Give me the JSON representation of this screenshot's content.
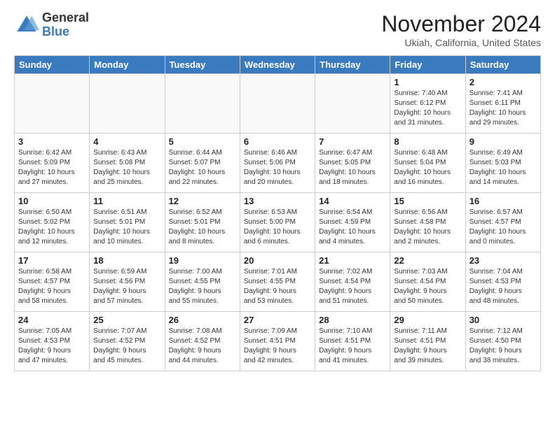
{
  "header": {
    "logo_general": "General",
    "logo_blue": "Blue",
    "month_title": "November 2024",
    "location": "Ukiah, California, United States"
  },
  "weekdays": [
    "Sunday",
    "Monday",
    "Tuesday",
    "Wednesday",
    "Thursday",
    "Friday",
    "Saturday"
  ],
  "weeks": [
    [
      {
        "day": "",
        "info": ""
      },
      {
        "day": "",
        "info": ""
      },
      {
        "day": "",
        "info": ""
      },
      {
        "day": "",
        "info": ""
      },
      {
        "day": "",
        "info": ""
      },
      {
        "day": "1",
        "info": "Sunrise: 7:40 AM\nSunset: 6:12 PM\nDaylight: 10 hours\nand 31 minutes."
      },
      {
        "day": "2",
        "info": "Sunrise: 7:41 AM\nSunset: 6:11 PM\nDaylight: 10 hours\nand 29 minutes."
      }
    ],
    [
      {
        "day": "3",
        "info": "Sunrise: 6:42 AM\nSunset: 5:09 PM\nDaylight: 10 hours\nand 27 minutes."
      },
      {
        "day": "4",
        "info": "Sunrise: 6:43 AM\nSunset: 5:08 PM\nDaylight: 10 hours\nand 25 minutes."
      },
      {
        "day": "5",
        "info": "Sunrise: 6:44 AM\nSunset: 5:07 PM\nDaylight: 10 hours\nand 22 minutes."
      },
      {
        "day": "6",
        "info": "Sunrise: 6:46 AM\nSunset: 5:06 PM\nDaylight: 10 hours\nand 20 minutes."
      },
      {
        "day": "7",
        "info": "Sunrise: 6:47 AM\nSunset: 5:05 PM\nDaylight: 10 hours\nand 18 minutes."
      },
      {
        "day": "8",
        "info": "Sunrise: 6:48 AM\nSunset: 5:04 PM\nDaylight: 10 hours\nand 16 minutes."
      },
      {
        "day": "9",
        "info": "Sunrise: 6:49 AM\nSunset: 5:03 PM\nDaylight: 10 hours\nand 14 minutes."
      }
    ],
    [
      {
        "day": "10",
        "info": "Sunrise: 6:50 AM\nSunset: 5:02 PM\nDaylight: 10 hours\nand 12 minutes."
      },
      {
        "day": "11",
        "info": "Sunrise: 6:51 AM\nSunset: 5:01 PM\nDaylight: 10 hours\nand 10 minutes."
      },
      {
        "day": "12",
        "info": "Sunrise: 6:52 AM\nSunset: 5:01 PM\nDaylight: 10 hours\nand 8 minutes."
      },
      {
        "day": "13",
        "info": "Sunrise: 6:53 AM\nSunset: 5:00 PM\nDaylight: 10 hours\nand 6 minutes."
      },
      {
        "day": "14",
        "info": "Sunrise: 6:54 AM\nSunset: 4:59 PM\nDaylight: 10 hours\nand 4 minutes."
      },
      {
        "day": "15",
        "info": "Sunrise: 6:56 AM\nSunset: 4:58 PM\nDaylight: 10 hours\nand 2 minutes."
      },
      {
        "day": "16",
        "info": "Sunrise: 6:57 AM\nSunset: 4:57 PM\nDaylight: 10 hours\nand 0 minutes."
      }
    ],
    [
      {
        "day": "17",
        "info": "Sunrise: 6:58 AM\nSunset: 4:57 PM\nDaylight: 9 hours\nand 58 minutes."
      },
      {
        "day": "18",
        "info": "Sunrise: 6:59 AM\nSunset: 4:56 PM\nDaylight: 9 hours\nand 57 minutes."
      },
      {
        "day": "19",
        "info": "Sunrise: 7:00 AM\nSunset: 4:55 PM\nDaylight: 9 hours\nand 55 minutes."
      },
      {
        "day": "20",
        "info": "Sunrise: 7:01 AM\nSunset: 4:55 PM\nDaylight: 9 hours\nand 53 minutes."
      },
      {
        "day": "21",
        "info": "Sunrise: 7:02 AM\nSunset: 4:54 PM\nDaylight: 9 hours\nand 51 minutes."
      },
      {
        "day": "22",
        "info": "Sunrise: 7:03 AM\nSunset: 4:54 PM\nDaylight: 9 hours\nand 50 minutes."
      },
      {
        "day": "23",
        "info": "Sunrise: 7:04 AM\nSunset: 4:53 PM\nDaylight: 9 hours\nand 48 minutes."
      }
    ],
    [
      {
        "day": "24",
        "info": "Sunrise: 7:05 AM\nSunset: 4:53 PM\nDaylight: 9 hours\nand 47 minutes."
      },
      {
        "day": "25",
        "info": "Sunrise: 7:07 AM\nSunset: 4:52 PM\nDaylight: 9 hours\nand 45 minutes."
      },
      {
        "day": "26",
        "info": "Sunrise: 7:08 AM\nSunset: 4:52 PM\nDaylight: 9 hours\nand 44 minutes."
      },
      {
        "day": "27",
        "info": "Sunrise: 7:09 AM\nSunset: 4:51 PM\nDaylight: 9 hours\nand 42 minutes."
      },
      {
        "day": "28",
        "info": "Sunrise: 7:10 AM\nSunset: 4:51 PM\nDaylight: 9 hours\nand 41 minutes."
      },
      {
        "day": "29",
        "info": "Sunrise: 7:11 AM\nSunset: 4:51 PM\nDaylight: 9 hours\nand 39 minutes."
      },
      {
        "day": "30",
        "info": "Sunrise: 7:12 AM\nSunset: 4:50 PM\nDaylight: 9 hours\nand 38 minutes."
      }
    ]
  ]
}
